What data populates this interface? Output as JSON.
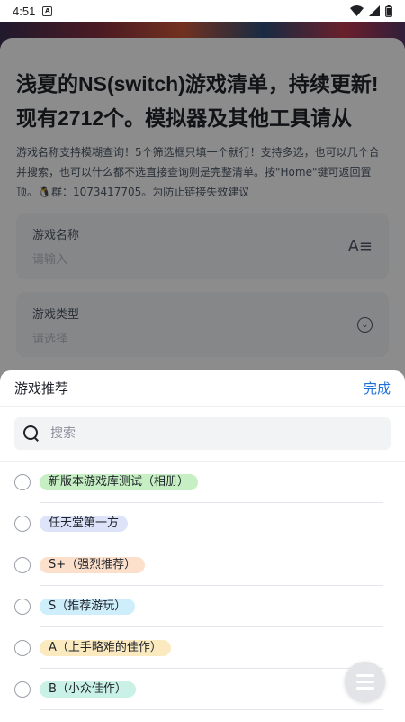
{
  "status_bar": {
    "time": "4:51",
    "notification_icon": "a-notification-icon",
    "wifi_icon": "wifi-icon",
    "signal_icon": "signal-icon",
    "battery_icon": "battery-icon"
  },
  "page": {
    "title": "浅夏的NS(switch)游戏清单，持续更新!现有2712个。模拟器及其他工具请从",
    "description": "游戏名称支持模糊查询！5个筛选框只填一个就行！支持多选，也可以几个合并搜索，也可以什么都不选直接查询则是完整清单。按\"Home\"键可返回置顶。🐧群：1073417705。为防止链接失效建议",
    "name_field": {
      "label": "游戏名称",
      "placeholder": "请输入",
      "icon": "text-format-icon"
    },
    "type_field": {
      "label": "游戏类型",
      "placeholder": "请选择",
      "icon": "chevron-down-circle-icon"
    }
  },
  "sheet": {
    "title": "游戏推荐",
    "done_label": "完成",
    "search_placeholder": "搜索",
    "options": [
      {
        "label": "新版本游戏库测试（相册）",
        "color": "#c7efc4"
      },
      {
        "label": "任天堂第一方",
        "color": "#dde3f9"
      },
      {
        "label": "S+（强烈推荐）",
        "color": "#fde0cc"
      },
      {
        "label": "S（推荐游玩）",
        "color": "#cdeefa"
      },
      {
        "label": "A（上手略难的佳作）",
        "color": "#fbeac0"
      },
      {
        "label": "B（小众佳作）",
        "color": "#c9f1e6"
      }
    ]
  },
  "fab": {
    "icon": "menu-icon"
  },
  "colors": {
    "accent": "#1e6fd9",
    "overlay": "rgba(0,0,0,0.45)"
  }
}
